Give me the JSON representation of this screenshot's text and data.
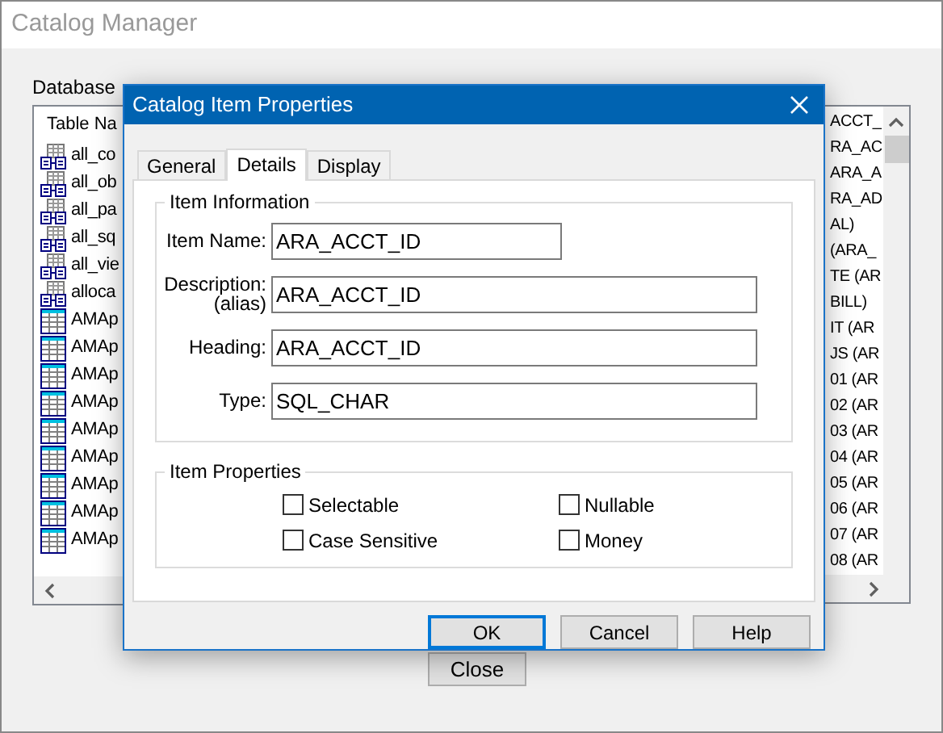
{
  "background_window": {
    "title": "Catalog Manager",
    "database_tables_label": "Database",
    "table_list": {
      "header": "Table Na",
      "items": [
        {
          "name": "all_co",
          "kind": "view"
        },
        {
          "name": "all_ob",
          "kind": "view"
        },
        {
          "name": "all_pa",
          "kind": "view"
        },
        {
          "name": "all_sq",
          "kind": "view"
        },
        {
          "name": "all_vie",
          "kind": "view"
        },
        {
          "name": "alloca",
          "kind": "view"
        },
        {
          "name": "AMAp",
          "kind": "table"
        },
        {
          "name": "AMAp",
          "kind": "table"
        },
        {
          "name": "AMAp",
          "kind": "table"
        },
        {
          "name": "AMAp",
          "kind": "table"
        },
        {
          "name": "AMAp",
          "kind": "table"
        },
        {
          "name": "AMAp",
          "kind": "table"
        },
        {
          "name": "AMAp",
          "kind": "table"
        },
        {
          "name": "AMAp",
          "kind": "table"
        },
        {
          "name": "AMAp",
          "kind": "table"
        }
      ]
    },
    "catalog_table_list": {
      "items": [
        "ACCT_",
        "RA_AC",
        "ARA_A",
        "RA_AD",
        "AL)",
        "(ARA_",
        "TE (AR",
        "BILL)",
        "IT (AR",
        "JS (AR",
        "01 (AR",
        "02 (AR",
        "03 (AR",
        "04 (AR",
        "05 (AR",
        "06 (AR",
        "07 (AR",
        "08 (AR"
      ]
    },
    "close_button": "Close"
  },
  "dialog": {
    "title": "Catalog Item Properties",
    "tabs": [
      {
        "label": "General",
        "selected": false
      },
      {
        "label": "Details",
        "selected": true
      },
      {
        "label": "Display",
        "selected": false
      }
    ],
    "item_information": {
      "title": "Item Information",
      "fields": [
        {
          "label": "Item Name:",
          "value": "ARA_ACCT_ID",
          "kind": "short"
        },
        {
          "label": "Description:",
          "sublabel": "(alias)",
          "value": "ARA_ACCT_ID",
          "kind": "wide"
        },
        {
          "label": "Heading:",
          "value": "ARA_ACCT_ID",
          "kind": "wide"
        },
        {
          "label": "Type:",
          "value": "SQL_CHAR",
          "kind": "wide"
        }
      ]
    },
    "item_properties": {
      "title": "Item Properties",
      "checkboxes": [
        {
          "label": "Selectable",
          "checked": false
        },
        {
          "label": "Nullable",
          "checked": false
        },
        {
          "label": "Case Sensitive",
          "checked": false
        },
        {
          "label": "Money",
          "checked": false
        }
      ]
    },
    "buttons": [
      {
        "label": "OK",
        "default": true
      },
      {
        "label": "Cancel",
        "default": false
      },
      {
        "label": "Help",
        "default": false
      }
    ]
  }
}
